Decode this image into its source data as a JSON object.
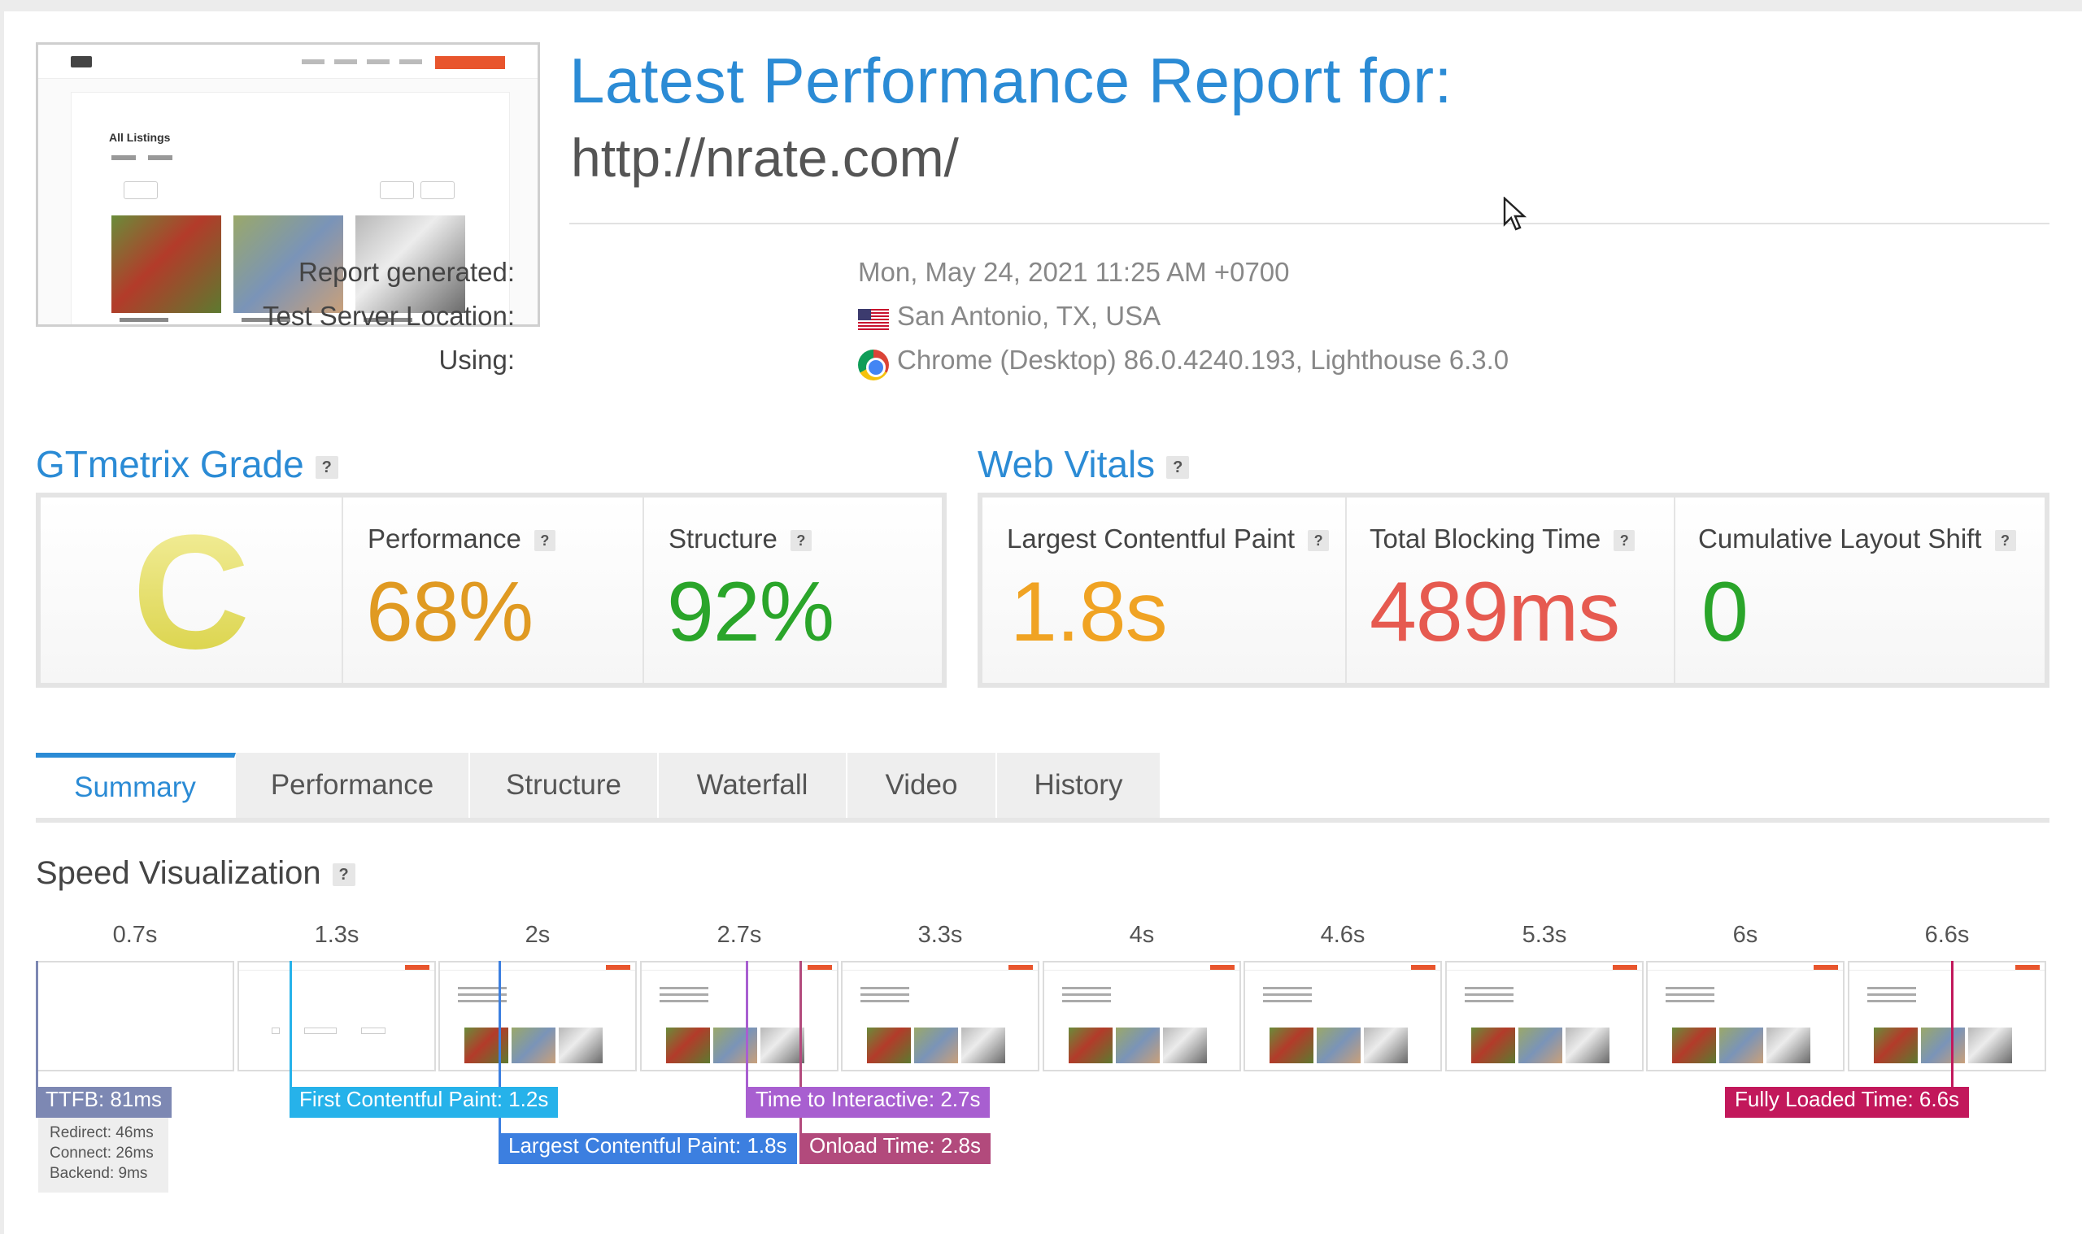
{
  "header": {
    "title": "Latest Performance Report for:",
    "url": "http://nrate.com/",
    "meta": [
      {
        "label": "Report generated:",
        "value": "Mon, May 24, 2021 11:25 AM +0700",
        "icon": ""
      },
      {
        "label": "Test Server Location:",
        "value": "San Antonio, TX, USA",
        "icon": "us-flag-icon"
      },
      {
        "label": "Using:",
        "value": "Chrome (Desktop) 86.0.4240.193, Lighthouse 6.3.0",
        "icon": "chrome-icon"
      }
    ]
  },
  "thumbnail": {
    "title": "All Listings"
  },
  "grade": {
    "heading": "GTmetrix Grade",
    "help": "?",
    "letter": "C",
    "performance_label": "Performance",
    "performance_value": "68%",
    "structure_label": "Structure",
    "structure_value": "92%"
  },
  "vitals": {
    "heading": "Web Vitals",
    "help": "?",
    "lcp_label": "Largest Contentful Paint",
    "lcp_value": "1.8s",
    "tbt_label": "Total Blocking Time",
    "tbt_value": "489ms",
    "cls_label": "Cumulative Layout Shift",
    "cls_value": "0"
  },
  "tabs": [
    "Summary",
    "Performance",
    "Structure",
    "Waterfall",
    "Video",
    "History"
  ],
  "speed": {
    "title": "Speed Visualization",
    "help": "?",
    "frames": [
      "0.7s",
      "1.3s",
      "2s",
      "2.7s",
      "3.3s",
      "4s",
      "4.6s",
      "5.3s",
      "6s",
      "6.6s"
    ],
    "markers": {
      "ttfb": "TTFB: 81ms",
      "fcp": "First Contentful Paint: 1.2s",
      "lcp": "Largest Contentful Paint: 1.8s",
      "tti": "Time to Interactive: 2.7s",
      "onload": "Onload Time: 2.8s",
      "fully": "Fully Loaded Time: 6.6s"
    },
    "ttfb_detail": {
      "redirect": "Redirect: 46ms",
      "connect": "Connect: 26ms",
      "backend": "Backend: 9ms"
    }
  },
  "colors": {
    "accent": "#2b8bd5",
    "performance": "#e09a22",
    "structure": "#2aa52a",
    "lcp": "#f0a323",
    "tbt": "#e65a50",
    "cls": "#2aa52a",
    "ttfb": "#7d88b3",
    "fcp": "#26b2ea",
    "lcp_marker": "#3c7fe0",
    "tti": "#a85fd0",
    "onload": "#b24a7c",
    "fully": "#c2185b"
  }
}
